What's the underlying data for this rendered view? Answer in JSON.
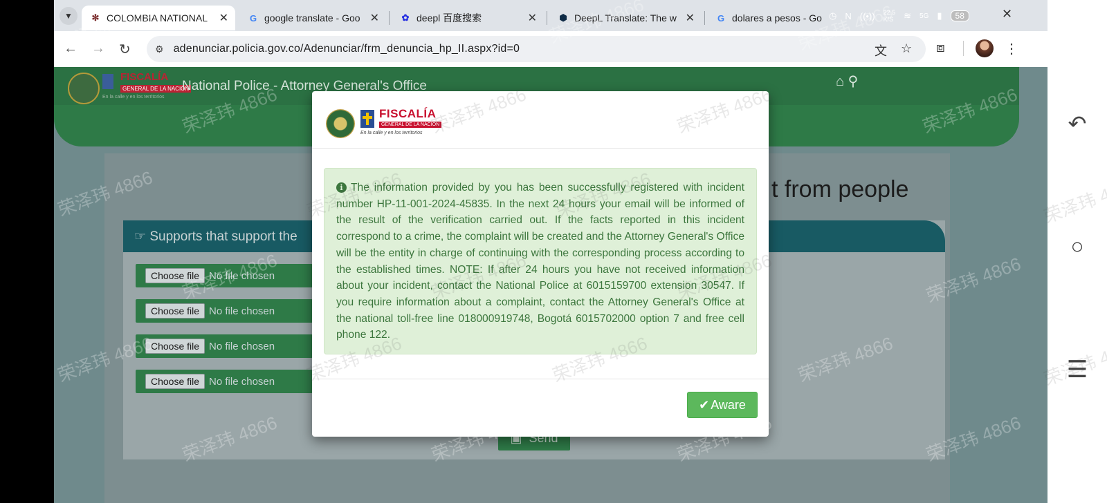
{
  "browser": {
    "tabs": [
      {
        "title": "COLOMBIA NATIONAL",
        "favicon": "police-shield-icon",
        "active": true
      },
      {
        "title": "google translate - Goo",
        "favicon": "google-g-icon",
        "active": false
      },
      {
        "title": "deepl 百度搜索",
        "favicon": "baidu-paw-icon",
        "active": false
      },
      {
        "title": "DeepL Translate: The w",
        "favicon": "deepl-icon",
        "active": false
      },
      {
        "title": "dolares a pesos - Go",
        "favicon": "google-g-icon",
        "active": false
      }
    ],
    "url": "adenunciar.policia.gov.co/Adenunciar/frm_denuncia_hp_II.aspx?id=0",
    "status": {
      "speed_top": "22.5",
      "speed_bottom": "K/S",
      "network": "5G",
      "battery": "58"
    }
  },
  "site": {
    "brand_name": "FISCALÍA",
    "brand_sub": "GENERAL DE LA NACIÓN",
    "brand_tagline": "En la calle y en los territorios",
    "title": "National Police - Attorney General's Office",
    "heading_fragment": "t from people"
  },
  "form": {
    "panel_title": "Supports that support the",
    "file_inputs": [
      {
        "button": "Choose file",
        "status": "No file chosen"
      },
      {
        "button": "Choose file",
        "status": "No file chosen"
      },
      {
        "button": "Choose file",
        "status": "No file chosen"
      },
      {
        "button": "Choose file",
        "status": "No file chosen"
      }
    ],
    "send_label": "Send"
  },
  "modal": {
    "brand_name": "FISCALÍA",
    "brand_sub": "GENERAL DE LA NACIÓN",
    "brand_tagline": "En la calle y en los territorios",
    "message": "The information provided by you has been successfully registered with incident number HP-11-001-2024-45835. In the next 24 hours your email will be informed of the result of the verification carried out. If the facts reported in this incident correspond to a crime, the complaint will be created and the Attorney General's Office will be the entity in charge of continuing with the corresponding process according to the established times. NOTE: If after 24 hours you have not received information about your incident, contact the National Police at 6015159700 extension 30547. If you require information about a complaint, contact the Attorney General's Office at the national toll-free line 018000919748, Bogotá 6015702000 option 7 and free cell phone 122.",
    "aware_label": "Aware"
  },
  "watermark": "荣泽玮 4866",
  "colors": {
    "success_text": "#3c763d",
    "success_bg": "#dff0d8",
    "button_green": "#5cb85c",
    "brand_red": "#c8102e"
  }
}
